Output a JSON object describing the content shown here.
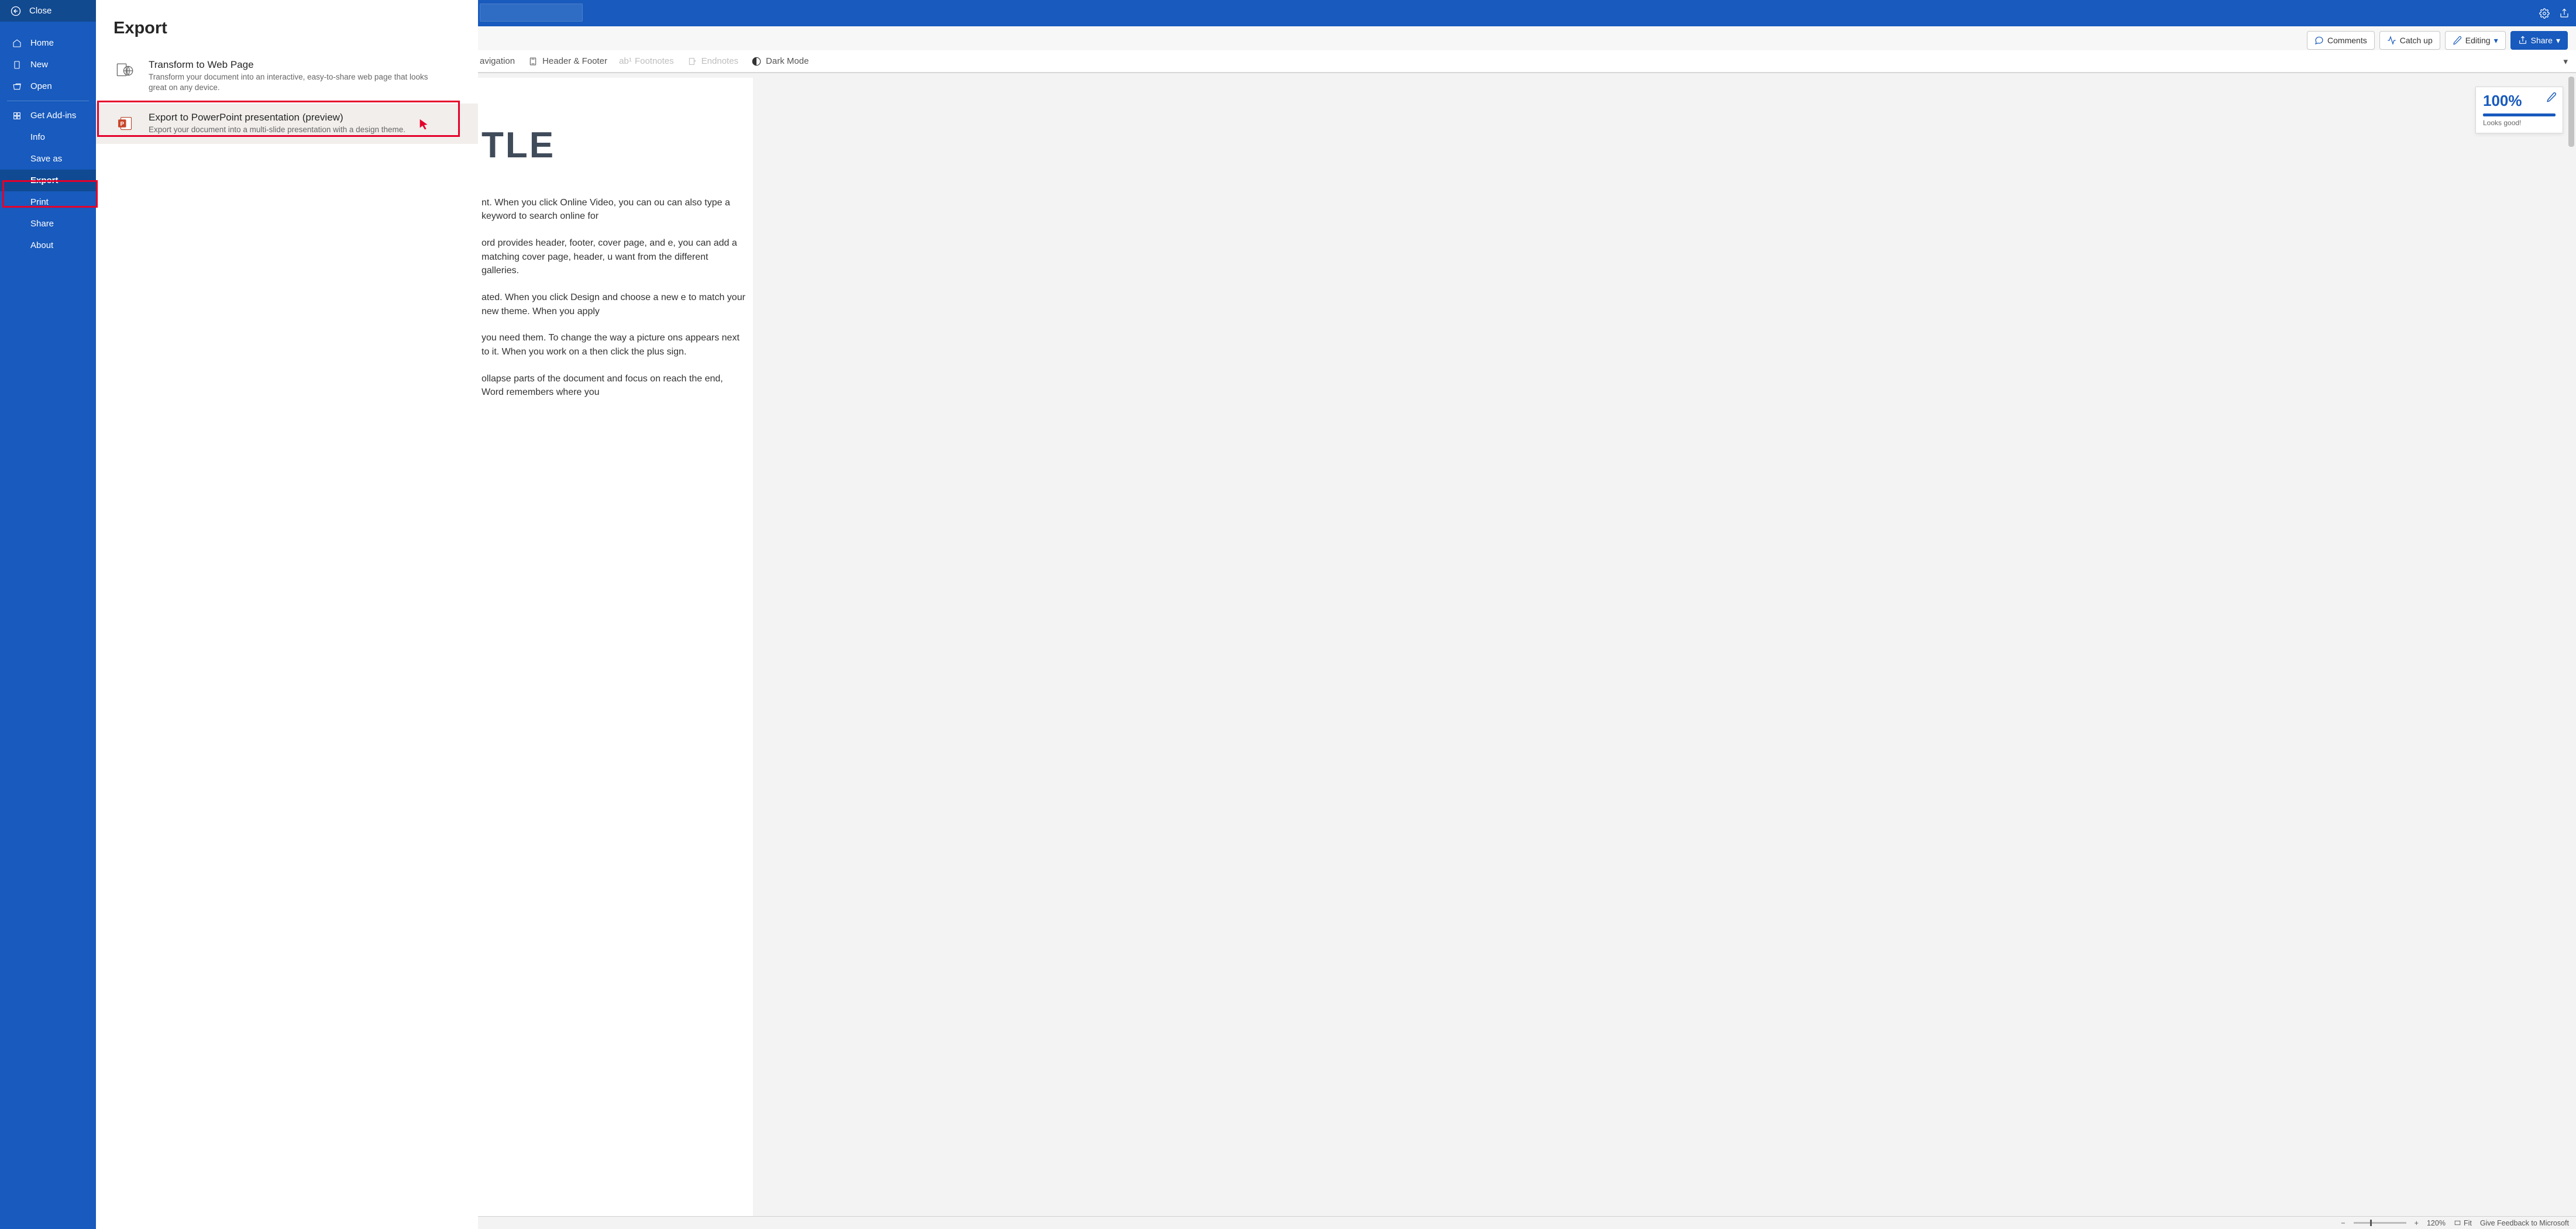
{
  "titlebar": {
    "settings_icon": "gear",
    "share_icon": "share-external"
  },
  "ribbon": {
    "comments": "Comments",
    "catchup": "Catch up",
    "editing": "Editing",
    "share": "Share"
  },
  "lower_ribbon": {
    "navigation": "avigation",
    "header_footer": "Header & Footer",
    "footnotes": "Footnotes",
    "endnotes": "Endnotes",
    "dark_mode": "Dark Mode"
  },
  "backstage": {
    "close": "Close",
    "items": [
      {
        "icon": "home",
        "label": "Home"
      },
      {
        "icon": "new",
        "label": "New"
      },
      {
        "icon": "open",
        "label": "Open"
      }
    ],
    "items2": [
      {
        "icon": "addins",
        "label": "Get Add-ins"
      },
      {
        "icon": "",
        "label": "Info"
      },
      {
        "icon": "",
        "label": "Save as"
      },
      {
        "icon": "",
        "label": "Export"
      },
      {
        "icon": "",
        "label": "Print"
      },
      {
        "icon": "",
        "label": "Share"
      },
      {
        "icon": "",
        "label": "About"
      }
    ]
  },
  "export_panel": {
    "title": "Export",
    "options": [
      {
        "title": "Transform to Web Page",
        "desc": "Transform your document into an interactive, easy-to-share web page that looks great on any device."
      },
      {
        "title": "Export to PowerPoint presentation (preview)",
        "desc": "Export your document into a multi-slide presentation with a design theme."
      }
    ]
  },
  "document": {
    "title_fragment": "TLE",
    "p1": "nt. When you click Online Video, you can ou can also type a keyword to search online for",
    "p2": "ord provides header, footer, cover page, and e, you can add a matching cover page, header, u want from the different galleries.",
    "p3": "ated. When you click Design and choose a new e to match your new theme. When you apply",
    "p4": "you need them. To change the way a picture ons appears next to it. When you work on a then click the plus sign.",
    "p5": "ollapse parts of the document and focus on reach the end, Word remembers where you"
  },
  "editor_card": {
    "score": "100%",
    "label": "Looks good!"
  },
  "statusbar": {
    "zoom": "120%",
    "fit": "Fit",
    "feedback": "Give Feedback to Microsoft"
  }
}
